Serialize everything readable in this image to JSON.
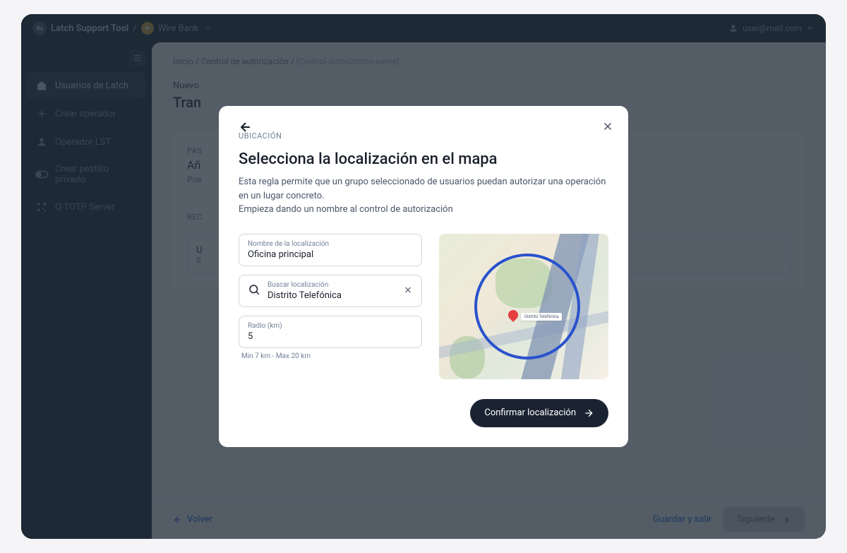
{
  "header": {
    "app_name": "Latch Support Tool",
    "separator": "/",
    "brand": "Wire Bank",
    "user": "user@mail.com"
  },
  "sidebar": {
    "items": [
      {
        "label": "Usuarios de Latch",
        "active": true
      },
      {
        "label": "Crear operador",
        "active": false
      },
      {
        "label": "Operador LST",
        "active": false
      },
      {
        "label": "Crear pestillo privado",
        "active": false
      },
      {
        "label": "Q-TOTP Server",
        "active": false
      }
    ]
  },
  "breadcrumb": {
    "item1": "Inicio",
    "item2": "Control de autorización",
    "item3": "[Control-autorization-name]"
  },
  "page": {
    "overline": "Nuevo",
    "title": "Tran"
  },
  "content": {
    "step_label": "PAS",
    "step_title": "Añ",
    "step_desc": "Pue",
    "rec_label": "REC",
    "user_line": "U",
    "user_sub": "S"
  },
  "footer": {
    "back": "Volver",
    "save_exit": "Guardar y salir",
    "next": "Siguiente"
  },
  "modal": {
    "section_label": "UBICACIÓN",
    "title": "Selecciona la localización en el mapa",
    "desc_line1": "Esta regla permite que un grupo seleccionado de usuarios puedan autorizar una operación en un lugar concreto.",
    "desc_line2": "Empieza dando un nombre al control de autorización",
    "name_label": "Nombre de la localización",
    "name_value": "Oficina principal",
    "search_label": "Buscar localización",
    "search_value": "Distrito Telefónica",
    "radius_label": "Radio (km)",
    "radius_value": "5",
    "radius_hint": "Min 7 km - Max 20 km",
    "map_pin_label": "Distrito Telefónica",
    "confirm": "Confirmar localización"
  }
}
